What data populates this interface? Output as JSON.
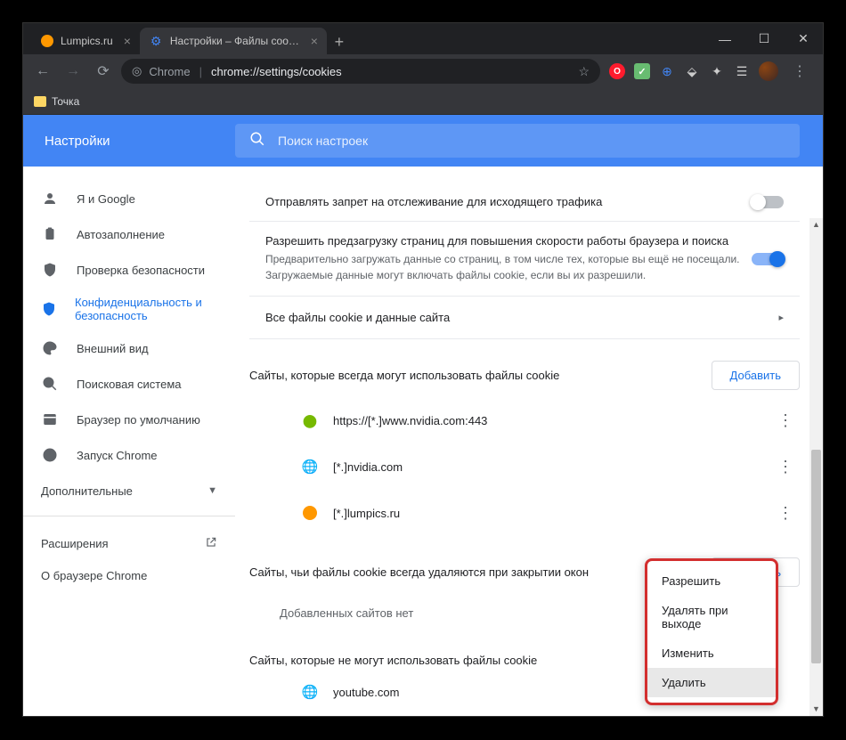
{
  "tabs": [
    {
      "title": "Lumpics.ru",
      "icon": "orange"
    },
    {
      "title": "Настройки – Файлы cookie и др",
      "icon": "gear"
    }
  ],
  "omnibox": {
    "prefix": "Chrome",
    "url": "chrome://settings/cookies"
  },
  "bookmarks": {
    "folder": "Точка"
  },
  "header": {
    "title": "Настройки",
    "search_placeholder": "Поиск настроек"
  },
  "sidebar": {
    "items": [
      {
        "label": "Я и Google",
        "icon": "person"
      },
      {
        "label": "Автозаполнение",
        "icon": "clipboard"
      },
      {
        "label": "Проверка безопасности",
        "icon": "shield-check"
      },
      {
        "label": "Конфиденциальность и безопасность",
        "icon": "shield",
        "active": true
      },
      {
        "label": "Внешний вид",
        "icon": "palette"
      },
      {
        "label": "Поисковая система",
        "icon": "search"
      },
      {
        "label": "Браузер по умолчанию",
        "icon": "browser"
      },
      {
        "label": "Запуск Chrome",
        "icon": "power"
      }
    ],
    "advanced": "Дополнительные",
    "extensions": "Расширения",
    "about": "О браузере Chrome"
  },
  "settings": {
    "dnt": {
      "title": "Отправлять запрет на отслеживание для исходящего трафика"
    },
    "preload": {
      "title": "Разрешить предзагрузку страниц для повышения скорости работы браузера и поиска",
      "desc": "Предварительно загружать данные со страниц, в том числе тех, которые вы ещё не посещали. Загружаемые данные могут включать файлы cookie, если вы их разрешили."
    },
    "all_cookies": "Все файлы cookie и данные сайта"
  },
  "sections": {
    "allow": {
      "title": "Сайты, которые всегда могут использовать файлы cookie",
      "add": "Добавить",
      "sites": [
        {
          "icon": "nvidia",
          "url": "https://[*.]www.nvidia.com:443"
        },
        {
          "icon": "globe",
          "url": "[*.]nvidia.com"
        },
        {
          "icon": "orange",
          "url": "[*.]lumpics.ru"
        }
      ]
    },
    "clear_on_exit": {
      "title": "Сайты, чьи файлы cookie всегда удаляются при закрытии окон",
      "add": "Добавить",
      "empty": "Добавленных сайтов нет"
    },
    "block": {
      "title": "Сайты, которые не могут использовать файлы cookie",
      "sites": [
        {
          "icon": "globe",
          "url": "youtube.com"
        }
      ]
    }
  },
  "context_menu": {
    "items": [
      "Разрешить",
      "Удалять при выходе",
      "Изменить",
      "Удалить"
    ],
    "hover_index": 3
  }
}
